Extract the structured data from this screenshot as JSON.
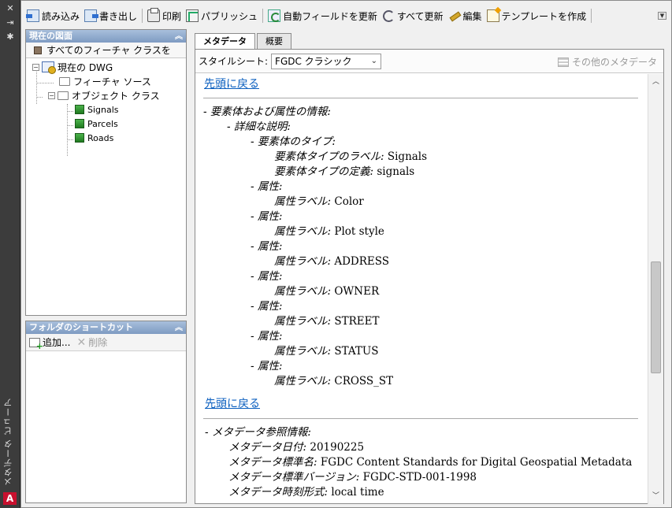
{
  "sidebar_strip": {
    "title": "メタデータ ビューア",
    "btn_close": "✕",
    "btn_pin": "⇥",
    "btn_settings": "✱",
    "logo": "A"
  },
  "toolbar": {
    "import": "読み込み",
    "export": "書き出し",
    "print": "印刷",
    "publish": "パブリッシュ",
    "auto_field": "自動フィールドを更新",
    "update_all": "すべて更新",
    "edit": "編集",
    "create_template": "テンプレートを作成"
  },
  "current_drawing": {
    "header": "現在の図面",
    "filter": "すべてのフィーチャ クラスを",
    "tree": {
      "root": "現在の DWG",
      "feature_source": "フィーチャ ソース",
      "object_class": "オブジェクト クラス",
      "layers": [
        "Signals",
        "Parcels",
        "Roads"
      ]
    }
  },
  "shortcuts": {
    "header": "フォルダのショートカット",
    "add": "追加...",
    "delete": "削除"
  },
  "tabs": [
    "メタデータ",
    "概要"
  ],
  "style_sheet": {
    "label": "スタイルシート:",
    "value": "FGDC クラシック",
    "other_metadata": "その他のメタデータ"
  },
  "doc": {
    "back_to_top": "先頭に戻る",
    "entity_section": "- 要素体および属性の情報:",
    "detailed": "- 詳細な説明:",
    "entity_type": "- 要素体のタイプ:",
    "entity_label_key": "要素体タイプのラベル:",
    "entity_label_val": "Signals",
    "entity_def_key": "要素体タイプの定義:",
    "entity_def_val": "signals",
    "attribute": "- 属性:",
    "attribute_label_key": "属性ラベル:",
    "attributes": [
      "Color",
      "Plot style",
      "ADDRESS",
      "OWNER",
      "STREET",
      "STATUS",
      "CROSS_ST"
    ],
    "meta_ref": "- メタデータ参照情報:",
    "meta_date_key": "メタデータ日付:",
    "meta_date_val": "20190225",
    "meta_std_key": "メタデータ標準名:",
    "meta_std_val": "FGDC Content Standards for Digital Geospatial Metadata",
    "meta_ver_key": "メタデータ標準バージョン:",
    "meta_ver_val": "FGDC-STD-001-1998",
    "meta_time_key": "メタデータ時刻形式:",
    "meta_time_val": "local time"
  }
}
